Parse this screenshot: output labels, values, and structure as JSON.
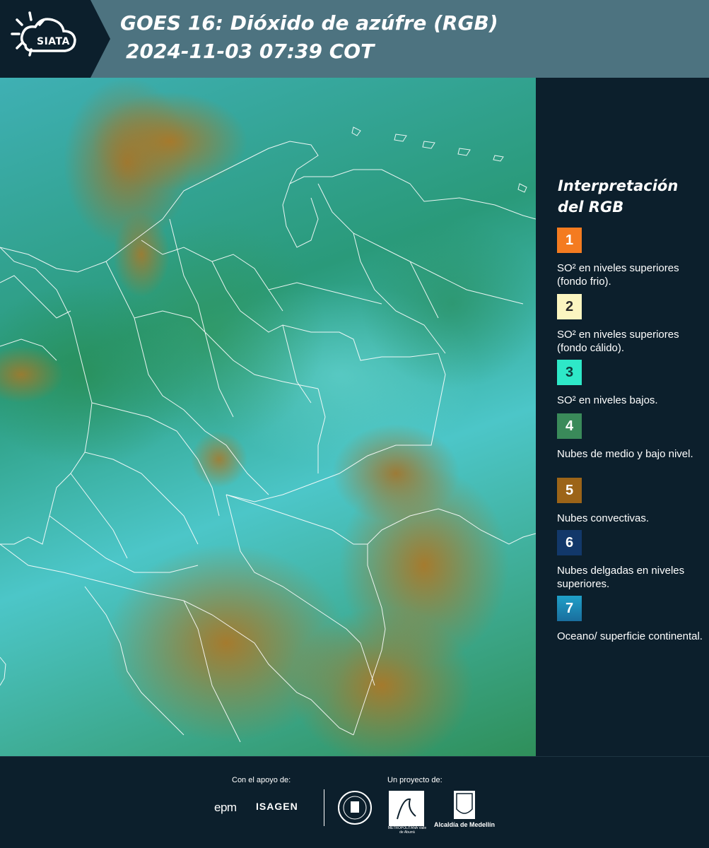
{
  "header": {
    "logo_text": "SIATA",
    "title": "GOES 16: Dióxido de azúfre (RGB)",
    "subtitle": "2024-11-03 07:39 COT"
  },
  "legend": {
    "title": "Interpretación del RGB",
    "items": [
      {
        "number": "1",
        "color": "#f47b20",
        "text_color": "#ffffff",
        "description": "SO² en niveles superiores (fondo frio)."
      },
      {
        "number": "2",
        "color": "#fbf5c0",
        "text_color": "#2b2b2b",
        "description": "SO² en niveles superiores (fondo cálido)."
      },
      {
        "number": "3",
        "color": "#2ee8c8",
        "text_color": "#0c3a3a",
        "description": "SO² en niveles bajos."
      },
      {
        "number": "4",
        "color": "#3a8a5a",
        "text_color": "#ffffff",
        "description": "Nubes de medio y bajo nivel."
      },
      {
        "number": "5",
        "color": "#9c6418",
        "text_color": "#ffffff",
        "description": "Nubes convectivas."
      },
      {
        "number": "6",
        "color": "#12386a",
        "text_color": "#ffffff",
        "description": "Nubes delgadas en niveles superiores."
      },
      {
        "number": "7",
        "color": "#1f8ab6",
        "text_color": "#ffffff",
        "description": "Oceano/ superficie continental."
      }
    ]
  },
  "footer": {
    "support_label": "Con el apoyo de:",
    "project_label": "Un proyecto de:",
    "sponsor_1": "epm",
    "sponsor_2": "ISAGEN",
    "partner_area": "METROPOLITANA Valle de Aburrá",
    "partner_alcaldia": "Alcaldía de Medellín"
  }
}
